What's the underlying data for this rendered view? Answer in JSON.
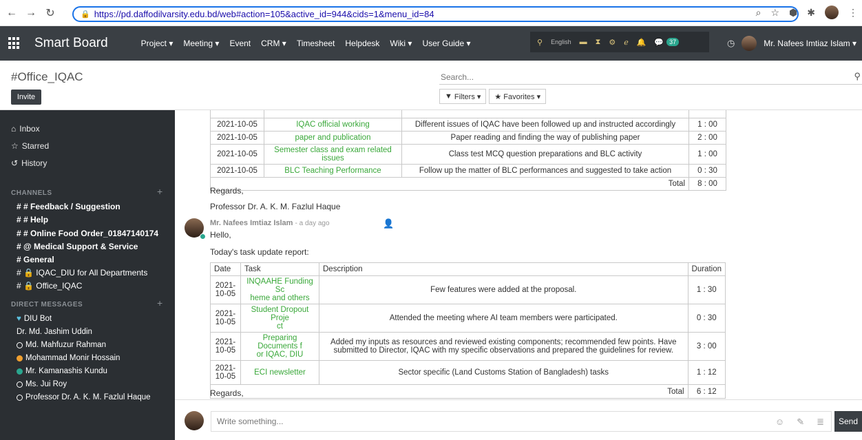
{
  "browser": {
    "url": "https://pd.daffodilvarsity.edu.bd/web#action=105&active_id=944&cids=1&menu_id=84"
  },
  "navbar": {
    "brand": "Smart Board",
    "menu": [
      "Project ▾",
      "Meeting ▾",
      "Event",
      "CRM ▾",
      "Timesheet",
      "Helpdesk",
      "Wiki ▾",
      "User Guide ▾"
    ],
    "lang": "English",
    "message_count": "37",
    "user_name": "Mr. Nafees Imtiaz Islam ▾"
  },
  "control": {
    "channel_title": "#Office_IQAC",
    "invite_label": "Invite",
    "search_placeholder": "Search...",
    "filters_label": "Filters ▾",
    "favorites_label": "Favorites ▾"
  },
  "sidebar": {
    "links": [
      "Inbox",
      "Starred",
      "History"
    ],
    "channels_header": "CHANNELS",
    "channels": [
      {
        "label": "# # Feedback / Suggestion",
        "bold": true
      },
      {
        "label": "# # Help",
        "bold": true
      },
      {
        "label": "# # Online Food Order_01847140174",
        "bold": true
      },
      {
        "label": "# @ Medical Support & Service",
        "bold": true
      },
      {
        "label": "# General",
        "bold": true
      },
      {
        "label": "# 🔒 IQAC_DIU for All Departments",
        "bold": false
      },
      {
        "label": "# 🔒 Office_IQAC",
        "bold": false
      }
    ],
    "dm_header": "DIRECT MESSAGES",
    "dms": [
      {
        "label": "DIU Bot",
        "status": "heart",
        "color": "#5bc0de"
      },
      {
        "label": "Dr. Md. Jashim Uddin",
        "status": "none",
        "color": ""
      },
      {
        "label": "Md. Mahfuzur Rahman",
        "status": "offline",
        "color": ""
      },
      {
        "label": "Mohammad Monir Hossain",
        "status": "away",
        "color": "#f0a030"
      },
      {
        "label": "Mr. Kamanashis Kundu",
        "status": "online",
        "color": "#2aa68e"
      },
      {
        "label": "Ms. Jui Roy",
        "status": "offline",
        "color": ""
      },
      {
        "label": "Professor Dr. A. K. M. Fazlul Haque",
        "status": "offline",
        "color": ""
      }
    ]
  },
  "thread": {
    "msg1": {
      "rows": [
        {
          "date": "2021-10-05",
          "task": "IQAC official working",
          "description": "Different issues of IQAC have been followed up and instructed accordingly",
          "duration": "1 : 00"
        },
        {
          "date": "2021-10-05",
          "task": "paper and publication",
          "description": "Paper reading and finding the way of publishing paper",
          "duration": "2 : 00"
        },
        {
          "date": "2021-10-05",
          "task": "Semester class and exam related issues",
          "description": "Class test MCQ question preparations and BLC activity",
          "duration": "1 : 00"
        },
        {
          "date": "2021-10-05",
          "task": "BLC Teaching Performance",
          "description": "Follow up the matter of BLC performances and suggested to take action",
          "duration": "0 : 30"
        }
      ],
      "total_label": "Total",
      "total": "8 : 00",
      "regards": "Regards,",
      "signature": "Professor Dr. A. K. M. Fazlul Haque"
    },
    "msg2": {
      "author": "Mr. Nafees Imtiaz Islam",
      "ago": "- a day ago",
      "hello": "Hello,",
      "intro": "Today's task update report:",
      "headers": [
        "Date",
        "Task",
        "Description",
        "Duration"
      ],
      "rows": [
        {
          "date": "2021-\n10-05",
          "task": "INQAAHE Funding Sc\nheme and others",
          "description": "Few features were added at the proposal.",
          "duration": "1 : 30"
        },
        {
          "date": "2021-\n10-05",
          "task": "Student Dropout Proje\nct",
          "description": "Attended the meeting where AI team members were participated.",
          "duration": "0 : 30"
        },
        {
          "date": "2021-\n10-05",
          "task": "Preparing Documents f\nor IQAC, DIU",
          "description": "Added my inputs as resources and reviewed existing components; recommended few points. Have submitted to Director, IQAC with my specific observations and prepared the guidelines for review.",
          "duration": "3 : 00"
        },
        {
          "date": "2021-\n10-05",
          "task": "ECI newsletter",
          "description": "Sector specific (Land Customs Station of Bangladesh) tasks",
          "duration": "1 : 12"
        }
      ],
      "total_label": "Total",
      "total": "6 : 12",
      "regards": "Regards,"
    }
  },
  "composer": {
    "placeholder": "Write something...",
    "send_label": "Send"
  }
}
